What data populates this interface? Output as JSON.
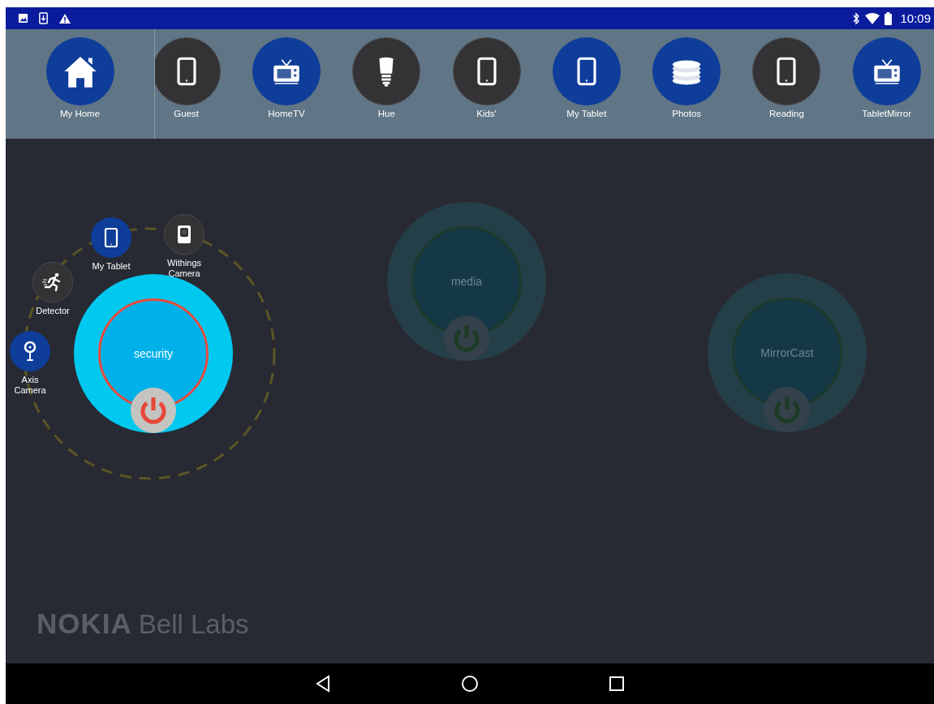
{
  "status_bar": {
    "time": "10:09"
  },
  "home": {
    "label": "My Home"
  },
  "devices": [
    {
      "label": "Guest",
      "kind": "tablet",
      "active": false
    },
    {
      "label": "HomeTV",
      "kind": "tv",
      "active": true
    },
    {
      "label": "Hue",
      "kind": "bulb",
      "active": false
    },
    {
      "label": "Kids'",
      "kind": "tablet",
      "active": false
    },
    {
      "label": "My Tablet",
      "kind": "tablet",
      "active": true
    },
    {
      "label": "Photos",
      "kind": "stack",
      "active": true
    },
    {
      "label": "Reading",
      "kind": "tablet",
      "active": false
    },
    {
      "label": "TabletMirror",
      "kind": "tv",
      "active": true
    }
  ],
  "groups": [
    {
      "name": "security",
      "on": true,
      "members": [
        {
          "label": "My Tablet",
          "kind": "tablet",
          "active": true
        },
        {
          "label": "Withings Camera",
          "kind": "camera",
          "active": false
        },
        {
          "label": "Detector",
          "kind": "runner",
          "active": false
        },
        {
          "label": "Axis Camera",
          "kind": "pin",
          "active": true
        }
      ]
    },
    {
      "name": "media",
      "on": false
    },
    {
      "name": "MirrorCast",
      "on": false
    }
  ],
  "logo": {
    "brand": "NOKIA",
    "lab": "Bell Labs"
  }
}
